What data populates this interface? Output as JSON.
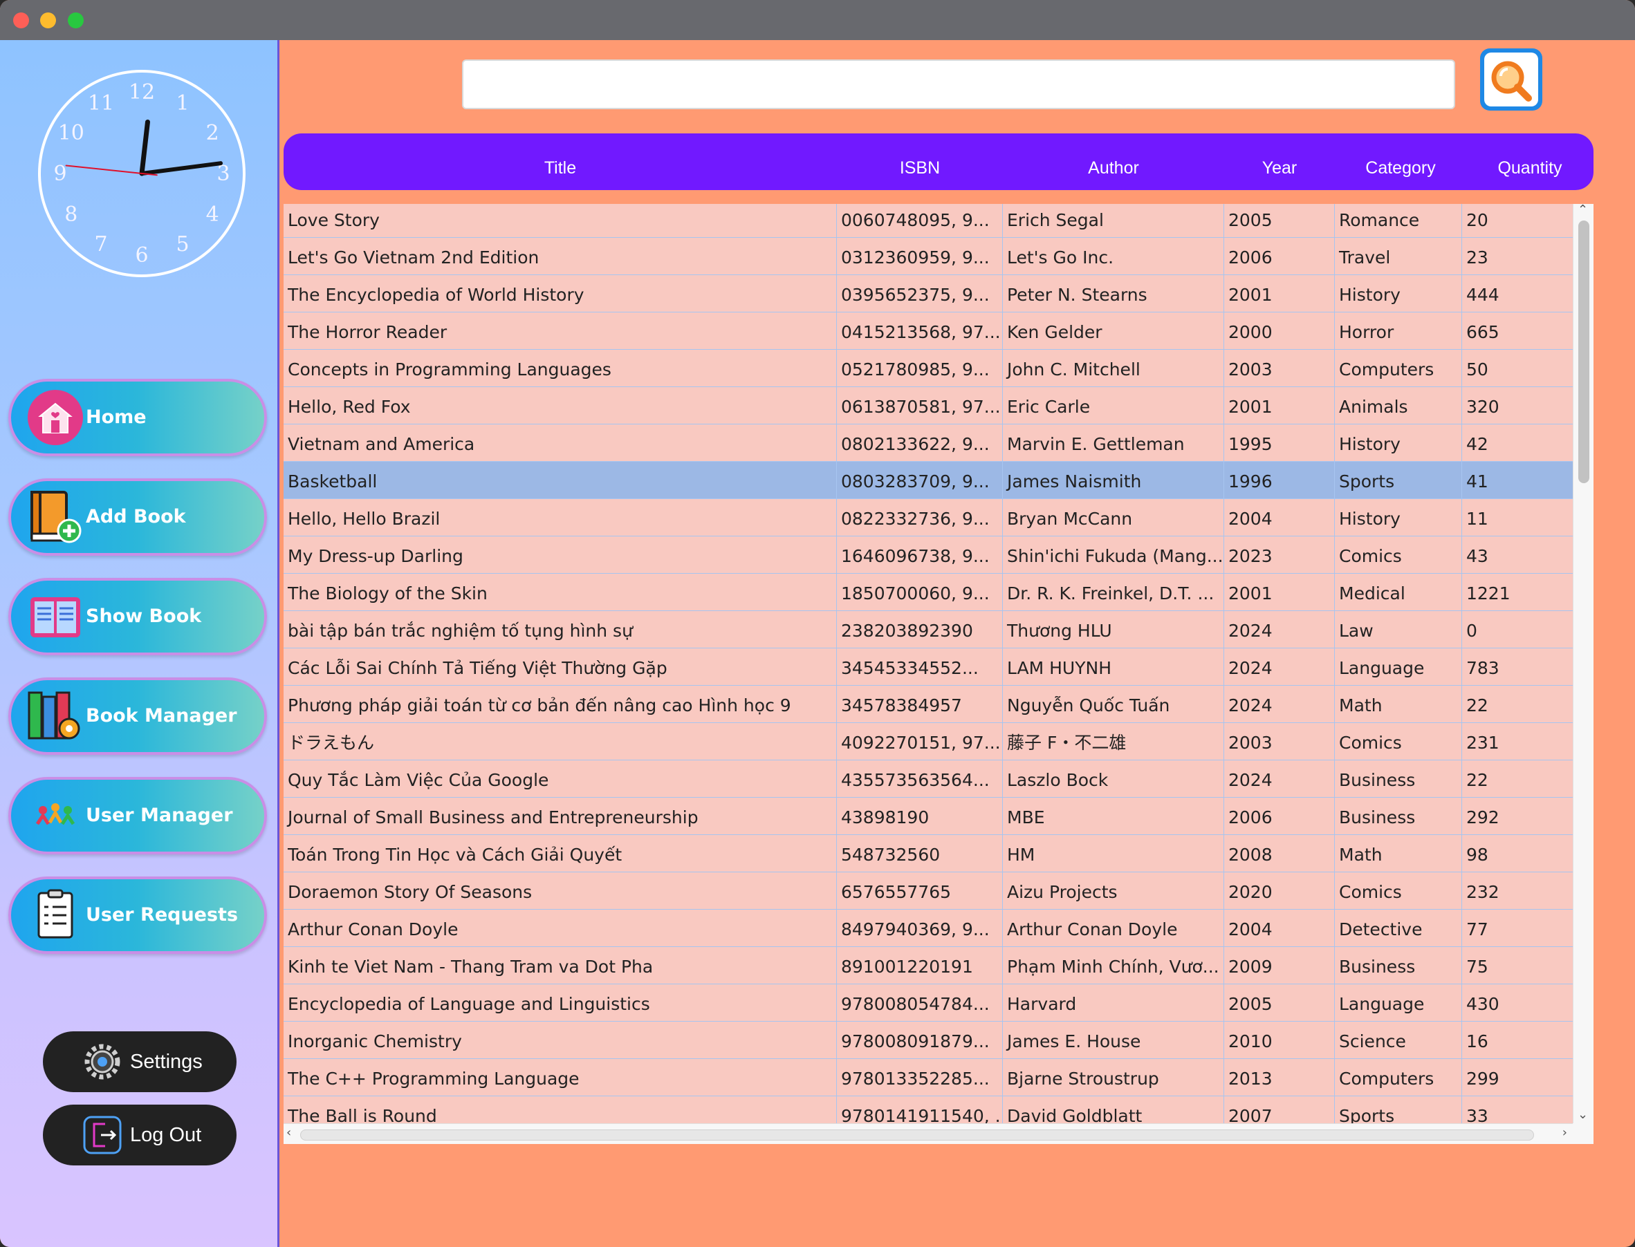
{
  "window": {
    "controls": [
      "close",
      "minimize",
      "zoom"
    ]
  },
  "clock": {
    "numerals": [
      "12",
      "1",
      "2",
      "3",
      "4",
      "5",
      "6",
      "7",
      "8",
      "9",
      "10",
      "11"
    ],
    "time_shown": "12:13:46"
  },
  "sidebar": {
    "nav": [
      {
        "label": "Home",
        "icon": "home-icon"
      },
      {
        "label": "Add Book",
        "icon": "add-book-icon"
      },
      {
        "label": "Show Book",
        "icon": "open-book-icon"
      },
      {
        "label": "Book Manager",
        "icon": "book-manager-icon"
      },
      {
        "label": "User Manager",
        "icon": "users-icon"
      },
      {
        "label": "User Requests",
        "icon": "clipboard-icon"
      }
    ],
    "settings_label": "Settings",
    "logout_label": "Log Out"
  },
  "search": {
    "value": "",
    "placeholder": ""
  },
  "table": {
    "columns": [
      "Title",
      "ISBN",
      "Author",
      "Year",
      "Category",
      "Quantity"
    ],
    "selected_row": 7,
    "rows": [
      [
        "Love Story",
        "0060748095, 9...",
        "Erich Segal",
        "2005",
        "Romance",
        "20"
      ],
      [
        "Let's Go Vietnam 2nd Edition",
        "0312360959, 9...",
        "Let's Go Inc.",
        "2006",
        "Travel",
        "23"
      ],
      [
        "The Encyclopedia of World History",
        "0395652375, 9...",
        "Peter N. Stearns",
        "2001",
        "History",
        "444"
      ],
      [
        "The Horror Reader",
        "0415213568, 97...",
        "Ken Gelder",
        "2000",
        "Horror",
        "665"
      ],
      [
        "Concepts in Programming Languages",
        "0521780985, 9...",
        "John C. Mitchell",
        "2003",
        "Computers",
        "50"
      ],
      [
        "Hello, Red Fox",
        "0613870581, 97...",
        "Eric Carle",
        "2001",
        "Animals",
        "320"
      ],
      [
        "Vietnam and America",
        "0802133622, 9...",
        "Marvin E. Gettleman",
        "1995",
        "History",
        "42"
      ],
      [
        "Basketball",
        "0803283709, 9...",
        "James Naismith",
        "1996",
        "Sports",
        "41"
      ],
      [
        "Hello, Hello Brazil",
        "0822332736, 9...",
        "Bryan McCann",
        "2004",
        "History",
        "11"
      ],
      [
        "My Dress-up Darling",
        "1646096738, 9...",
        "Shin'ichi Fukuda (Mang...",
        "2023",
        "Comics",
        "43"
      ],
      [
        "The Biology of the Skin",
        "1850700060, 9...",
        "Dr. R. K. Freinkel, D.T. ...",
        "2001",
        "Medical",
        "1221"
      ],
      [
        "bài tập bán trắc nghiệm tố tụng hình sự",
        "238203892390",
        "Thương HLU",
        "2024",
        "Law",
        "0"
      ],
      [
        "Các Lỗi Sai Chính Tả Tiếng Việt Thường Gặp",
        "34545334552...",
        "LAM HUYNH",
        "2024",
        "Language",
        "783"
      ],
      [
        "Phương pháp giải toán từ cơ bản đến nâng cao Hình học 9",
        "34578384957",
        "Nguyễn Quốc Tuấn",
        "2024",
        "Math",
        "22"
      ],
      [
        "ドラえもん",
        "4092270151, 97...",
        "藤子 F・不二雄",
        "2003",
        "Comics",
        "231"
      ],
      [
        "Quy Tắc Làm Việc Của Google",
        "435573563564...",
        "Laszlo Bock",
        "2024",
        "Business",
        "22"
      ],
      [
        "Journal of Small Business and Entrepreneurship",
        "43898190",
        "MBE",
        "2006",
        "Business",
        "292"
      ],
      [
        "Toán Trong Tin Học và Cách Giải Quyết",
        "548732560",
        "HM",
        "2008",
        "Math",
        "98"
      ],
      [
        "Doraemon Story Of Seasons",
        "6576557765",
        "Aizu Projects",
        "2020",
        "Comics",
        "232"
      ],
      [
        "Arthur Conan Doyle",
        "8497940369, 9...",
        "Arthur Conan Doyle",
        "2004",
        "Detective",
        "77"
      ],
      [
        "Kinh te Viet Nam - Thang Tram va Dot Pha",
        "891001220191",
        "Phạm Minh Chính, Vươ...",
        "2009",
        "Business",
        "75"
      ],
      [
        "Encyclopedia of Language and Linguistics",
        "978008054784...",
        "Harvard",
        "2005",
        "Language",
        "430"
      ],
      [
        "Inorganic Chemistry",
        "978008091879...",
        "James E. House",
        "2010",
        "Science",
        "16"
      ],
      [
        "The C++ Programming Language",
        "978013352285...",
        "Bjarne Stroustrup",
        "2013",
        "Computers",
        "299"
      ],
      [
        "The Ball is Round",
        "9780141911540, ...",
        "David Goldblatt",
        "2007",
        "Sports",
        "33"
      ]
    ]
  },
  "colors": {
    "background": "#ff9a72",
    "header": "#7119ff",
    "row": "#f9c9c1",
    "selected_row": "#9cb8e5",
    "nav_gradient_start": "#1fa5ee",
    "nav_gradient_end": "#76d1c8"
  }
}
